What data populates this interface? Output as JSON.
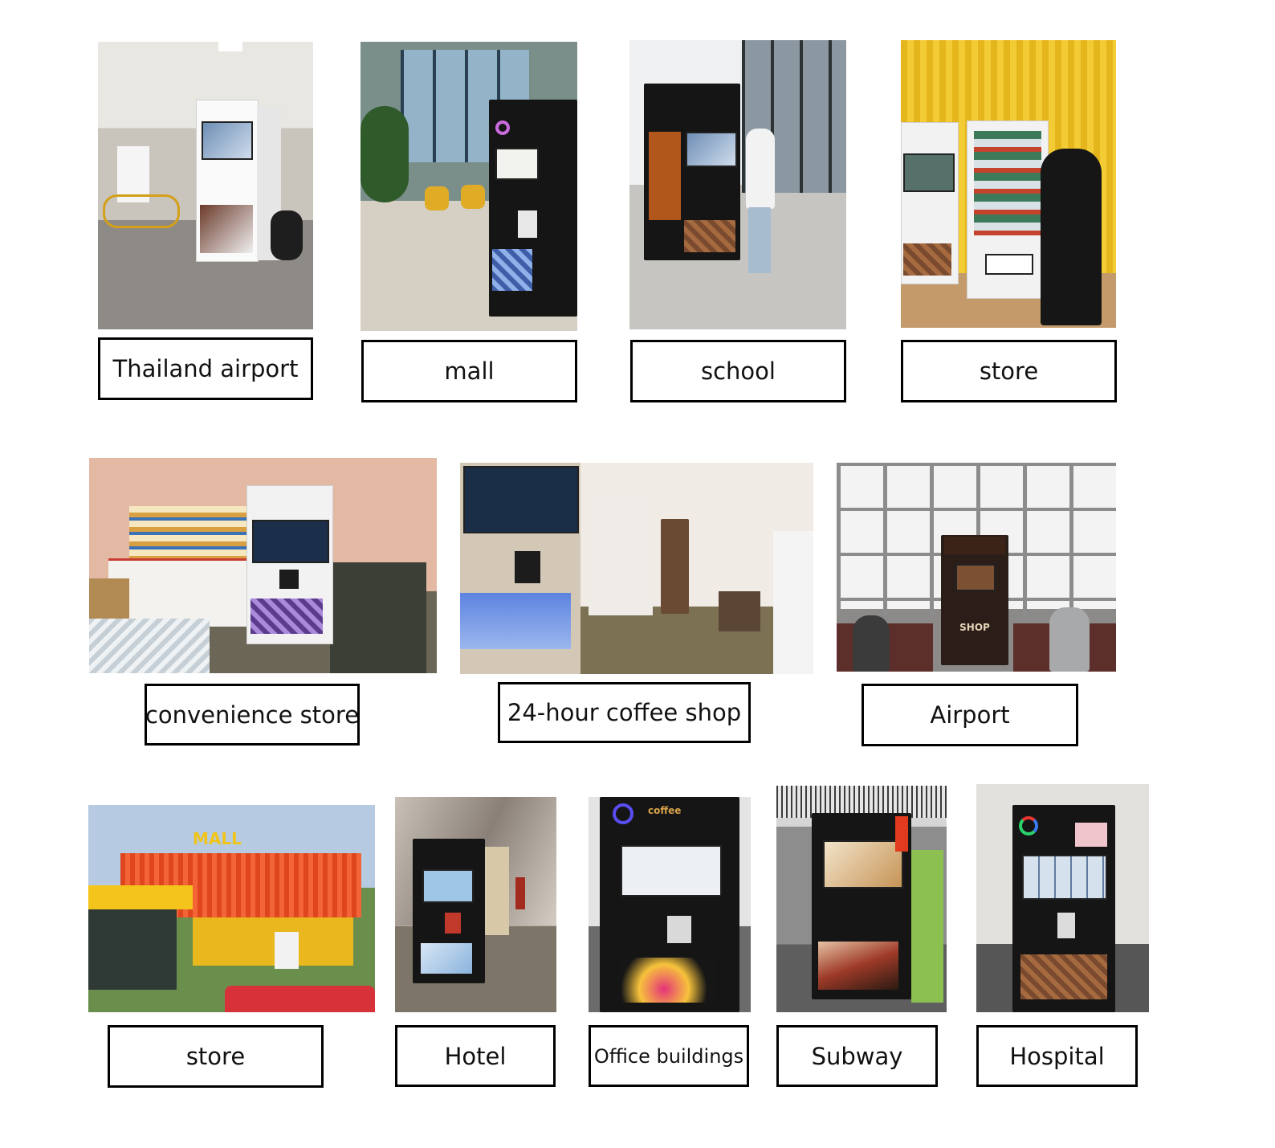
{
  "rows": [
    {
      "items": [
        {
          "label": "Thailand airport",
          "photo_alt": "White coffee vending machine in an airport hall with a yellow bicycle"
        },
        {
          "label": "mall",
          "photo_alt": "Black coffee vending machine in a mall lobby with yellow chairs"
        },
        {
          "label": "school",
          "photo_alt": "Person using a black coffee vending machine at a school"
        },
        {
          "label": "store",
          "photo_alt": "White vending machines against a yellow corrugated wall"
        }
      ]
    },
    {
      "items": [
        {
          "label": "convenience store",
          "photo_alt": "White coffee machine in a convenience store next to freezers"
        },
        {
          "label": "24-hour coffee shop",
          "photo_alt": "Built-in coffee machines with blue lit panels in a coffee shop"
        },
        {
          "label": "Airport",
          "photo_alt": "Coffee vending machine in an airport waiting lounge"
        }
      ]
    },
    {
      "items": [
        {
          "label": "store",
          "photo_alt": "Orange and yellow container-style MALL storefront"
        },
        {
          "label": "Hotel",
          "photo_alt": "Black coffee vending machine in a marble hotel corridor"
        },
        {
          "label": "Office buildings",
          "photo_alt": "Black coffee vending machine in an office building"
        },
        {
          "label": "Subway",
          "photo_alt": "Coffee vending machine in a subway station"
        },
        {
          "label": "Hospital",
          "photo_alt": "Black coffee vending machine with coffee bean panel in a hospital"
        }
      ]
    }
  ],
  "signage": {
    "mall_sign": "MALL",
    "shop_sign": "SHOP",
    "coffee_text": "coffee"
  },
  "colors": {
    "caption_border": "#000000",
    "machine_black": "#151515",
    "container_orange": "#f0552a",
    "container_yellow": "#f3c51a"
  }
}
